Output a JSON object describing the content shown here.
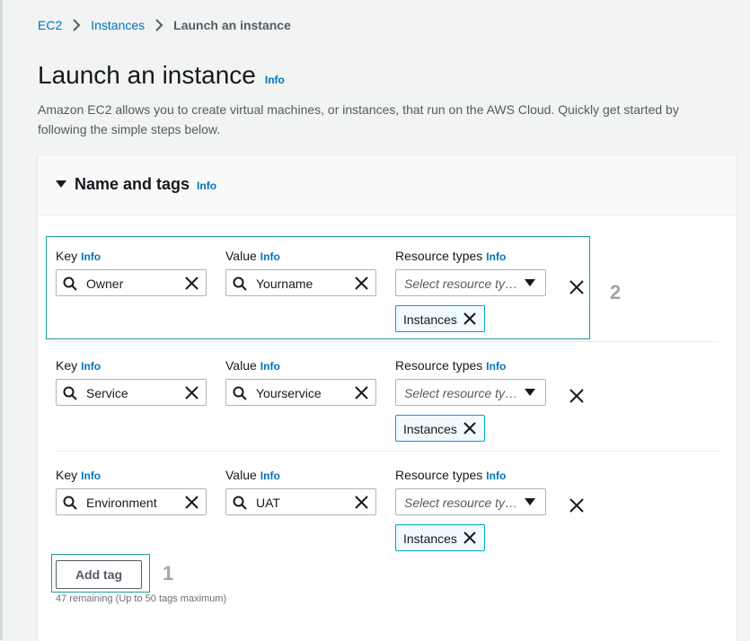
{
  "breadcrumb": {
    "items": [
      "EC2",
      "Instances"
    ],
    "current": "Launch an instance"
  },
  "page": {
    "title": "Launch an instance",
    "info": "Info",
    "description": "Amazon EC2 allows you to create virtual machines, or instances, that run on the AWS Cloud. Quickly get started by following the simple steps below."
  },
  "panel": {
    "title": "Name and tags",
    "info": "Info"
  },
  "labels": {
    "key": "Key",
    "value": "Value",
    "resource_types": "Resource types",
    "info": "Info"
  },
  "tags": [
    {
      "key": "Owner",
      "value": "Yourname",
      "resource_placeholder": "Select resource types",
      "token": "Instances"
    },
    {
      "key": "Service",
      "value": "Yourservice",
      "resource_placeholder": "Select resource types",
      "token": "Instances"
    },
    {
      "key": "Environment",
      "value": "UAT",
      "resource_placeholder": "Select resource types",
      "token": "Instances"
    }
  ],
  "add_tag": {
    "label": "Add tag",
    "remaining": "47 remaining (Up to 50 tags maximum)"
  },
  "annotations": {
    "step1": "1",
    "step2": "2"
  },
  "colors": {
    "link": "#0073bb",
    "highlight": "#1b9e8f",
    "token_border": "#00a1c9",
    "token_bg": "#f1faff"
  }
}
